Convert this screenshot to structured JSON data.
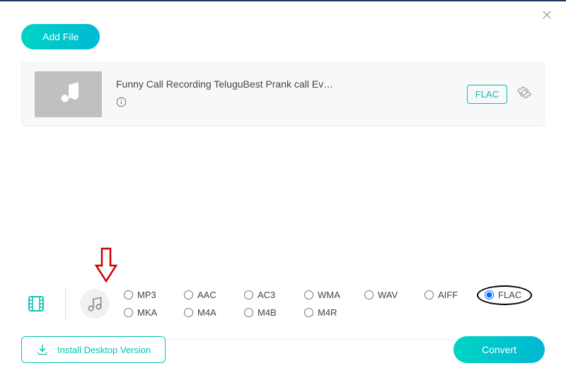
{
  "header": {
    "add_file_label": "Add File"
  },
  "file": {
    "title": "Funny Call Recording TeluguBest Prank call Ev…",
    "format_badge": "FLAC"
  },
  "formats": {
    "row1": [
      "MP3",
      "AAC",
      "AC3",
      "WMA",
      "WAV",
      "AIFF",
      "FLAC"
    ],
    "row2": [
      "MKA",
      "M4A",
      "M4B",
      "M4R"
    ],
    "selected": "FLAC"
  },
  "footer": {
    "install_label": "Install Desktop Version",
    "convert_label": "Convert"
  }
}
